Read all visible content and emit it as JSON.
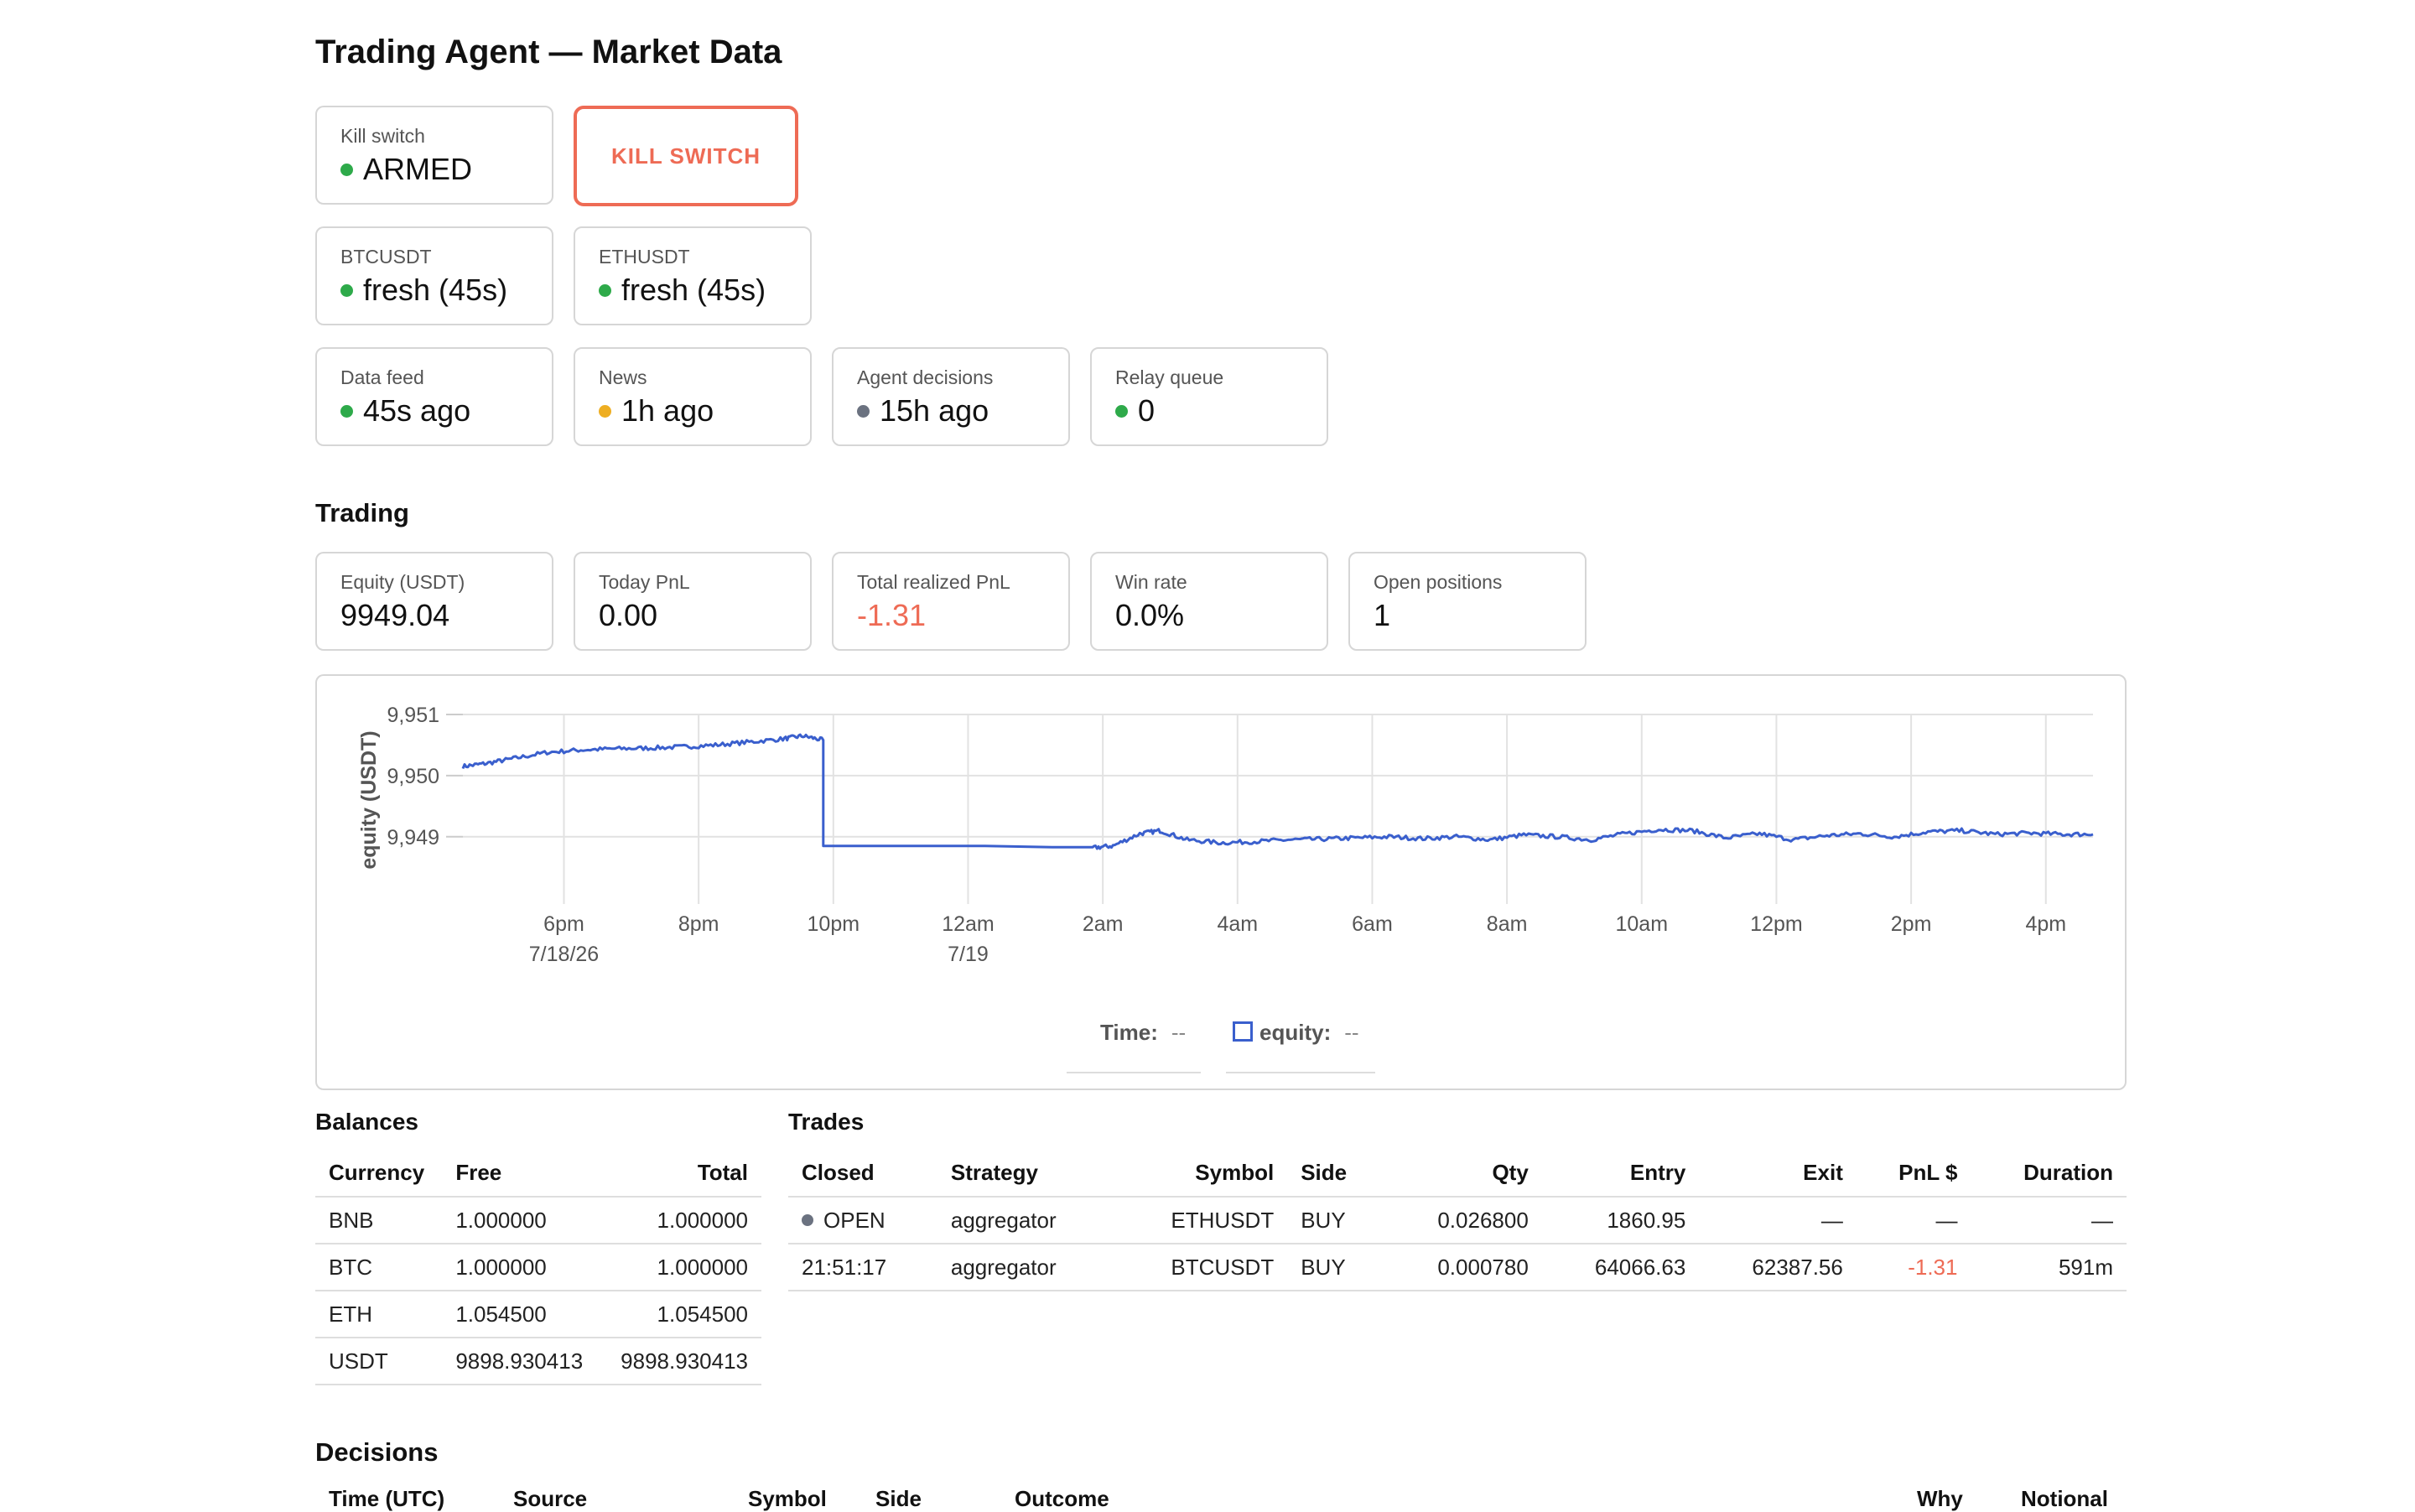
{
  "app": {
    "title": "Trading Agent — Market Data"
  },
  "colors": {
    "ok": "#2eaa4a",
    "warn": "#eeae22",
    "neutral": "#6b7280",
    "danger": "#ee6b55",
    "line": "#3a5fcd"
  },
  "kill_switch": {
    "label": "Kill switch",
    "status": "ARMED",
    "status_color": "ok",
    "button_label": "KILL SWITCH"
  },
  "symbols": [
    {
      "label": "BTCUSDT",
      "value": "fresh (45s)",
      "color": "ok"
    },
    {
      "label": "ETHUSDT",
      "value": "fresh (45s)",
      "color": "ok"
    }
  ],
  "health": [
    {
      "label": "Data feed",
      "value": "45s ago",
      "color": "ok"
    },
    {
      "label": "News",
      "value": "1h ago",
      "color": "warn"
    },
    {
      "label": "Agent decisions",
      "value": "15h ago",
      "color": "neutral"
    },
    {
      "label": "Relay queue",
      "value": "0",
      "color": "ok"
    }
  ],
  "trading": {
    "title": "Trading",
    "cards": [
      {
        "label": "Equity (USDT)",
        "value": "9949.04"
      },
      {
        "label": "Today PnL",
        "value": "0.00"
      },
      {
        "label": "Total realized PnL",
        "value": "-1.31",
        "negative": true
      },
      {
        "label": "Win rate",
        "value": "0.0%"
      },
      {
        "label": "Open positions",
        "value": "1"
      }
    ]
  },
  "chart_data": {
    "type": "line",
    "ylabel": "equity (USDT)",
    "ylim": [
      9948.75,
      9951.0
    ],
    "yticks": [
      {
        "v": 9951,
        "label": "9,951"
      },
      {
        "v": 9950,
        "label": "9,950"
      },
      {
        "v": 9949,
        "label": "9,949"
      }
    ],
    "xlim": [
      16.25,
      40.45
    ],
    "xticks": [
      {
        "v": 17.75,
        "label": "6pm",
        "sub": "7/18/26"
      },
      {
        "v": 19.75,
        "label": "8pm"
      },
      {
        "v": 21.75,
        "label": "10pm"
      },
      {
        "v": 23.75,
        "label": "12am",
        "sub": "7/19"
      },
      {
        "v": 25.75,
        "label": "2am"
      },
      {
        "v": 27.75,
        "label": "4am"
      },
      {
        "v": 29.75,
        "label": "6am"
      },
      {
        "v": 31.75,
        "label": "8am"
      },
      {
        "v": 33.75,
        "label": "10am"
      },
      {
        "v": 35.75,
        "label": "12pm"
      },
      {
        "v": 37.75,
        "label": "2pm"
      },
      {
        "v": 39.75,
        "label": "4pm"
      }
    ],
    "series": [
      {
        "legend": "equity",
        "x": [
          16.25,
          16.6,
          17.0,
          17.5,
          18.0,
          18.5,
          19.0,
          19.5,
          20.0,
          20.5,
          21.0,
          21.3,
          21.6,
          21.6,
          22.0,
          23.0,
          24.0,
          25.0,
          25.6,
          25.9,
          26.3,
          26.6,
          27.0,
          27.5,
          28.0,
          28.5,
          29.0,
          29.5,
          30.0,
          30.5,
          31.0,
          31.5,
          32.0,
          32.5,
          33.0,
          33.5,
          34.0,
          34.5,
          35.0,
          35.5,
          36.0,
          36.5,
          37.0,
          37.5,
          38.0,
          38.5,
          39.0,
          39.5,
          40.0,
          40.45
        ],
        "y": [
          9950.15,
          9950.2,
          9950.28,
          9950.38,
          9950.42,
          9950.44,
          9950.45,
          9950.47,
          9950.5,
          9950.55,
          9950.6,
          9950.65,
          9950.58,
          9948.85,
          9948.85,
          9948.85,
          9948.85,
          9948.83,
          9948.82,
          9948.85,
          9949.05,
          9949.1,
          9948.95,
          9948.9,
          9948.92,
          9948.95,
          9948.96,
          9948.98,
          9949.0,
          9948.97,
          9949.0,
          9948.95,
          9949.03,
          9949.0,
          9948.95,
          9949.05,
          9949.12,
          9949.1,
          9948.98,
          9949.05,
          9948.95,
          9949.02,
          9949.05,
          9949.0,
          9949.08,
          9949.1,
          9949.04,
          9949.06,
          9949.04,
          9949.04
        ]
      }
    ]
  },
  "legend": {
    "time_label": "Time:",
    "time_value": "--",
    "equity_label": "equity:",
    "equity_value": "--"
  },
  "balances": {
    "title": "Balances",
    "headers": [
      "Currency",
      "Free",
      "Total"
    ],
    "rows": [
      [
        "BNB",
        "1.000000",
        "1.000000"
      ],
      [
        "BTC",
        "1.000000",
        "1.000000"
      ],
      [
        "ETH",
        "1.054500",
        "1.054500"
      ],
      [
        "USDT",
        "9898.930413",
        "9898.930413"
      ]
    ]
  },
  "trades": {
    "title": "Trades",
    "headers": [
      "Closed",
      "Strategy",
      "Symbol",
      "Side",
      "Qty",
      "Entry",
      "Exit",
      "PnL $",
      "Duration"
    ],
    "rows": [
      [
        "OPEN",
        "aggregator",
        "ETHUSDT",
        "BUY",
        "0.026800",
        "1860.95",
        "—",
        "—",
        "—"
      ],
      [
        "21:51:17",
        "aggregator",
        "BTCUSDT",
        "BUY",
        "0.000780",
        "64066.63",
        "62387.56",
        "-1.31",
        "591m"
      ]
    ]
  },
  "decisions": {
    "title": "Decisions",
    "headers": [
      "Time (UTC)",
      "Source",
      "Symbol",
      "Side",
      "Outcome",
      "Why",
      "Notional"
    ]
  }
}
